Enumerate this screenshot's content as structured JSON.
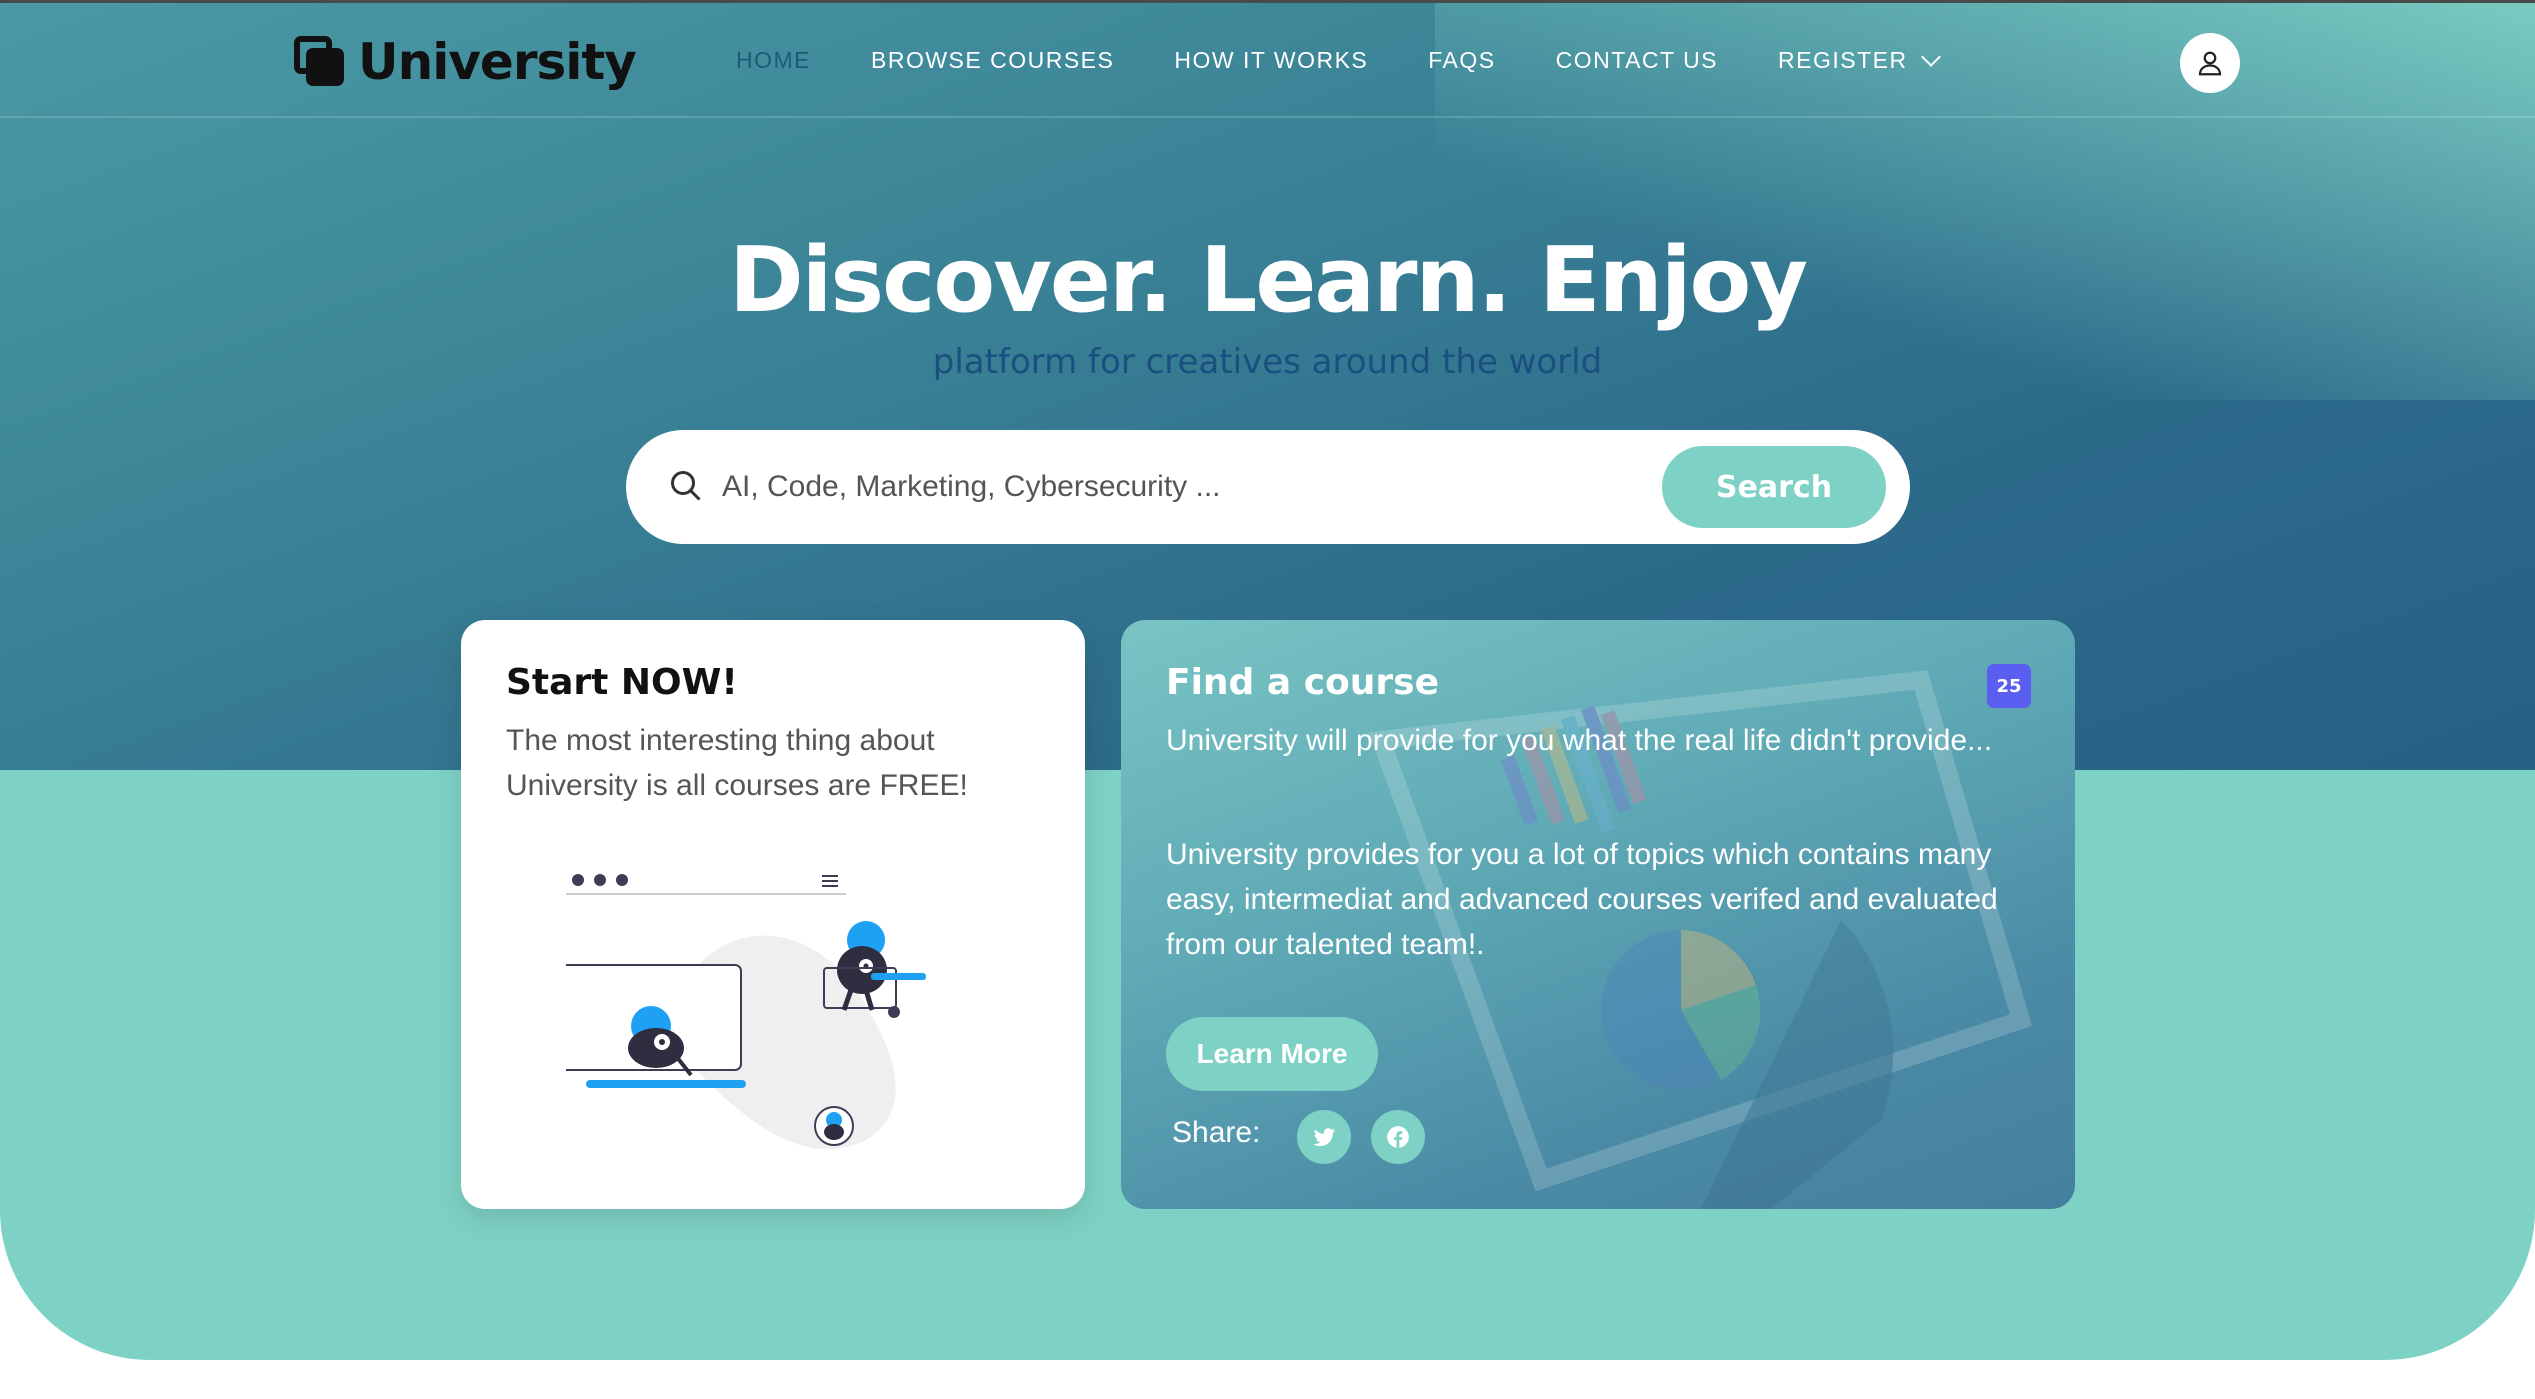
{
  "brand": {
    "name": "University"
  },
  "nav": {
    "items": [
      {
        "label": "HOME",
        "active": true
      },
      {
        "label": "BROWSE COURSES",
        "active": false
      },
      {
        "label": "HOW IT WORKS",
        "active": false
      },
      {
        "label": "FAQS",
        "active": false
      },
      {
        "label": "CONTACT US",
        "active": false
      },
      {
        "label": "REGISTER",
        "active": false
      }
    ]
  },
  "hero": {
    "title": "Discover. Learn. Enjoy",
    "subtitle": "platform for creatives around the world"
  },
  "search": {
    "placeholder": "AI, Code, Marketing, Cybersecurity ...",
    "button_label": "Search"
  },
  "start_card": {
    "title": "Start NOW!",
    "text": "The most interesting thing about University is all courses are FREE!"
  },
  "find_card": {
    "title": "Find a course",
    "badge": "25",
    "text1": "University will provide for you what the real life didn't provide...",
    "text2": "University provides for you a lot of topics which contains many easy, intermediat and advanced courses verifed and evaluated from our talented team!.",
    "button_label": "Learn More",
    "share_label": "Share:"
  },
  "icons": [
    "user-icon",
    "search-icon",
    "chevron-down-icon",
    "twitter-icon",
    "facebook-icon"
  ],
  "colors": {
    "teal": "#7ed1c5",
    "hero_dark": "#2c6a8a",
    "subtitle": "#1a4f80",
    "badge": "#5a5ff2",
    "accent_blue": "#1ea1f2"
  }
}
